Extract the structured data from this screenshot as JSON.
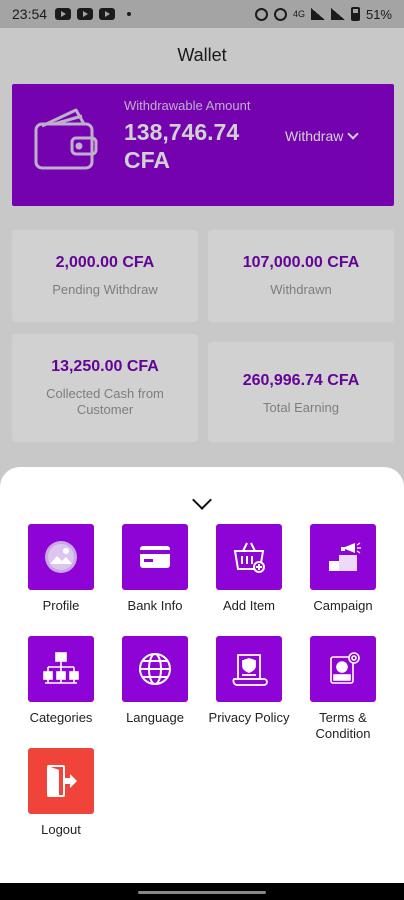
{
  "status_bar": {
    "time": "23:54",
    "battery": "51%",
    "network": "4G"
  },
  "page": {
    "title": "Wallet"
  },
  "wallet": {
    "label": "Withdrawable Amount",
    "amount": "138,746.74 CFA",
    "withdraw_label": "Withdraw"
  },
  "stats": [
    {
      "value": "2,000.00 CFA",
      "label": "Pending Withdraw"
    },
    {
      "value": "107,000.00 CFA",
      "label": "Withdrawn"
    },
    {
      "value": "13,250.00 CFA",
      "label": "Collected Cash from Customer"
    },
    {
      "value": "260,996.74 CFA",
      "label": "Total Earning"
    }
  ],
  "menu": {
    "items": [
      {
        "label": "Profile",
        "icon": "image-icon",
        "color": "#8e04d6"
      },
      {
        "label": "Bank Info",
        "icon": "card-icon",
        "color": "#8e04d6"
      },
      {
        "label": "Add Item",
        "icon": "basket-icon",
        "color": "#8e04d6"
      },
      {
        "label": "Campaign",
        "icon": "campaign-icon",
        "color": "#8e04d6"
      },
      {
        "label": "Categories",
        "icon": "categories-icon",
        "color": "#8e04d6"
      },
      {
        "label": "Language",
        "icon": "globe-icon",
        "color": "#8e04d6"
      },
      {
        "label": "Privacy Policy",
        "icon": "policy-icon",
        "color": "#8e04d6"
      },
      {
        "label": "Terms & Condition",
        "icon": "terms-icon",
        "color": "#8e04d6"
      },
      {
        "label": "Logout",
        "icon": "logout-icon",
        "color": "#f0443a"
      }
    ]
  }
}
